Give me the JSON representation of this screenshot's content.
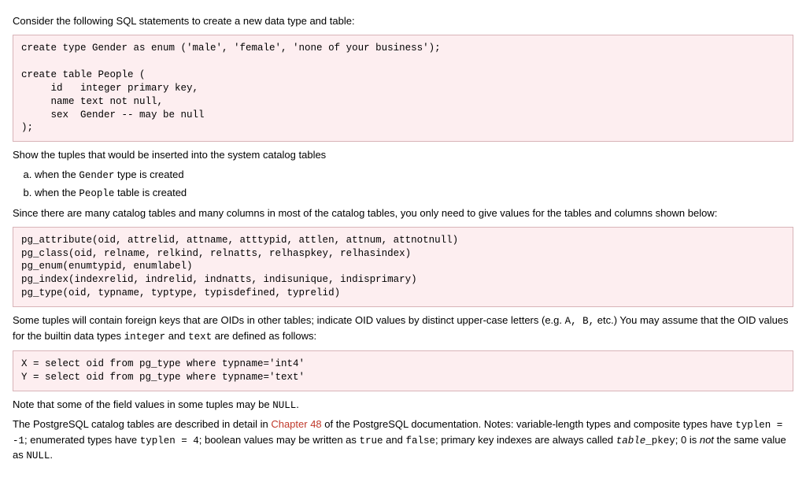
{
  "intro": "Consider the following SQL statements to create a new data type and table:",
  "sql_block": "create type Gender as enum ('male', 'female', 'none of your business');\n\ncreate table People (\n     id   integer primary key,\n     name text not null,\n     sex  Gender -- may be null\n);",
  "show_tuples": "Show the tuples that would be inserted into the system catalog tables",
  "subq": {
    "a_pre": "when the ",
    "a_code": "Gender",
    "a_post": " type is created",
    "b_pre": "when the ",
    "b_code": "People",
    "b_post": " table is created"
  },
  "since": "Since there are many catalog tables and many columns in most of the catalog tables, you only need to give values for the tables and columns shown below:",
  "catalog_block": "pg_attribute(oid, attrelid, attname, atttypid, attlen, attnum, attnotnull)\npg_class(oid, relname, relkind, relnatts, relhaspkey, relhasindex)\npg_enum(enumtypid, enumlabel)\npg_index(indexrelid, indrelid, indnatts, indisunique, indisprimary)\npg_type(oid, typname, typtype, typisdefined, typrelid)",
  "some_tuples_pre": "Some tuples will contain foreign keys that are OIDs in other tables; indicate OID values by distinct upper-case letters (e.g. ",
  "some_tuples_codes": "A, B,",
  "some_tuples_mid": " etc.) You may assume that the OID values for the builtin data types ",
  "int_code": "integer",
  "and_word": " and ",
  "text_code": "text",
  "some_tuples_post": " are defined as follows:",
  "oid_block": "X = select oid from pg_type where typname='int4'\nY = select oid from pg_type where typname='text'",
  "note_null_pre": "Note that some of the field values in some tuples may be ",
  "null_code": "NULL",
  "note_null_post": ".",
  "pg_doc_pre": "The PostgreSQL catalog tables are described in detail in ",
  "pg_doc_link": "Chapter 48",
  "pg_doc_mid1": " of the PostgreSQL documentation. Notes: variable-length types and composite types have ",
  "typlen_neg": "typlen = -1",
  "pg_doc_mid2": "; enumerated types have ",
  "typlen_four": "typlen = 4",
  "pg_doc_mid3": "; boolean values may be written as ",
  "true_code": "true",
  "and2": " and ",
  "false_code": "false",
  "pg_doc_mid4": "; primary key indexes are always called ",
  "table_pkey_code": "table",
  "pkey_suffix": "_pkey",
  "pg_doc_mid5": "; 0 is ",
  "not_word": "not",
  "pg_doc_mid6": " the same value as ",
  "null_code2": "NULL",
  "pg_doc_end": "."
}
